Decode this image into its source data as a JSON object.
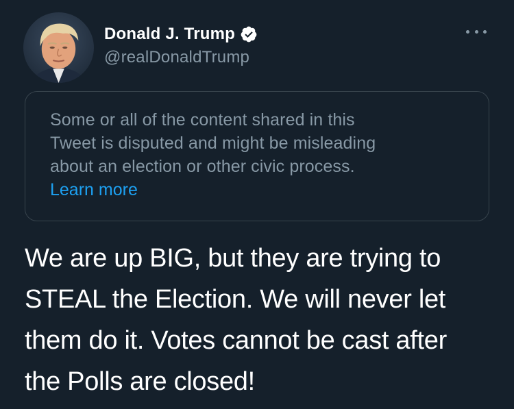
{
  "author": {
    "display_name": "Donald J. Trump",
    "handle": "@realDonaldTrump",
    "verified": true,
    "avatar_icon": "profile-photo"
  },
  "menu": {
    "icon": "more-options-icon"
  },
  "warning": {
    "line1": "Some or all of the content shared in this",
    "line2": "Tweet is disputed and might be misleading",
    "line3": "about an election or other civic process.",
    "link_label": "Learn more",
    "link_color": "#1da1f2"
  },
  "tweet": {
    "line1": "We are up BIG, but they are trying to",
    "line2": "STEAL the Election. We will never let",
    "line3": "them do it. Votes cannot be cast after",
    "line4": "the Polls are closed!"
  },
  "colors": {
    "background": "#15202b",
    "secondary_text": "#8899a6",
    "card_border": "#38444d",
    "accent": "#1da1f2"
  }
}
